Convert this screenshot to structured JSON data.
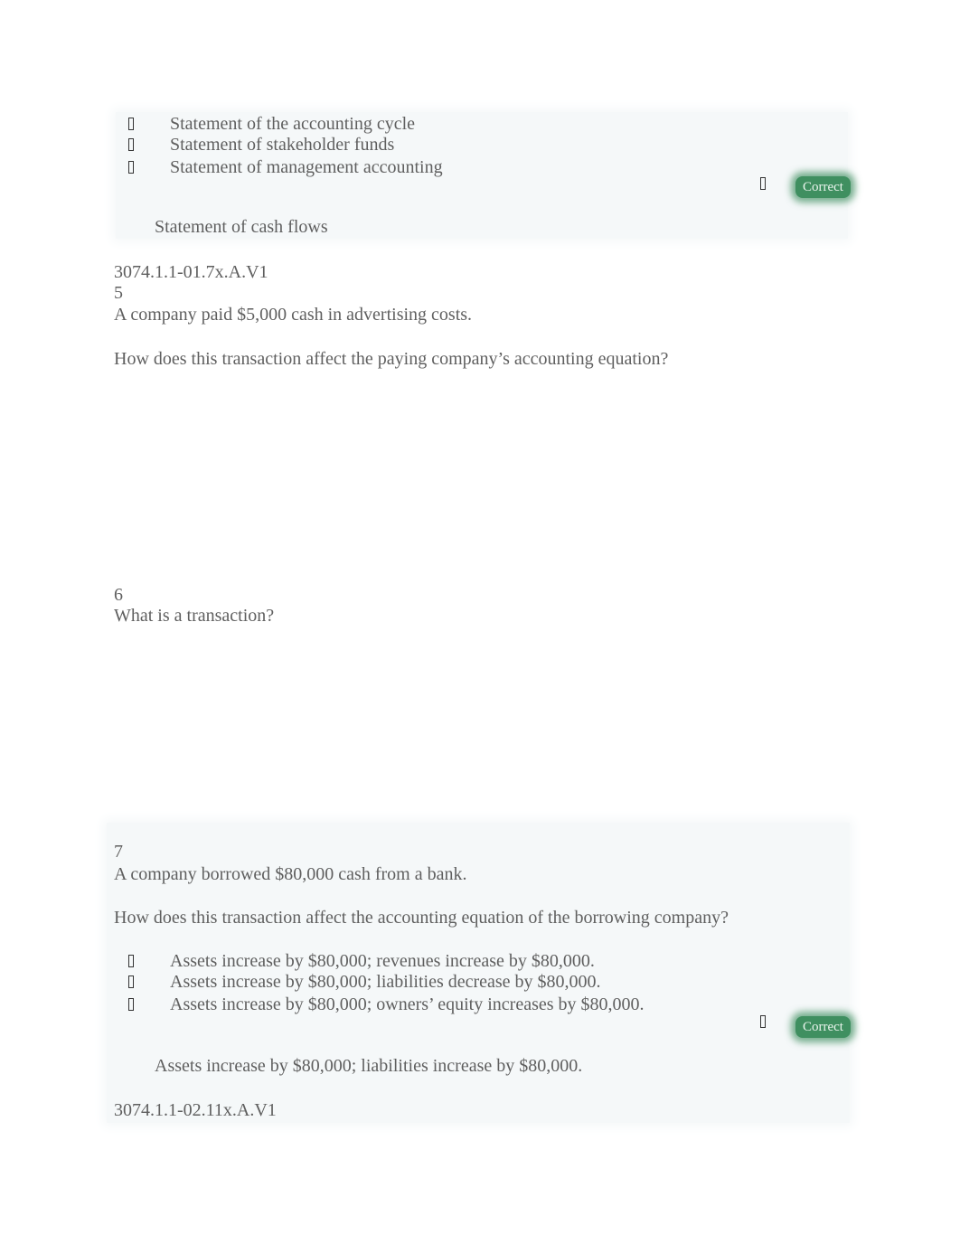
{
  "block1": {
    "options": [
      "Statement of the accounting cycle",
      "Statement of stakeholder funds",
      "Statement of management accounting"
    ],
    "status_badge": "Correct",
    "correct_answer": "Statement of cash flows",
    "question_id": "3074.1.1-01.7x.A.V1"
  },
  "q5": {
    "number": "5",
    "text": "A company paid $5,000 cash in advertising costs.",
    "prompt": "How does this transaction affect the paying company’s accounting equation?"
  },
  "q6": {
    "number": "6",
    "text": "What is a transaction?"
  },
  "q7": {
    "number": "7",
    "text": "A company borrowed $80,000 cash from a bank.",
    "prompt": "How does this transaction affect the accounting equation of the borrowing company?",
    "options": [
      "Assets increase by $80,000; revenues increase by $80,000.",
      "Assets increase by $80,000; liabilities decrease by $80,000.",
      "Assets increase by $80,000; owners’ equity increases by $80,000."
    ],
    "status_badge": "Correct",
    "correct_answer": "Assets increase by $80,000; liabilities increase by $80,000.",
    "question_id": "3074.1.1-02.11x.A.V1"
  }
}
